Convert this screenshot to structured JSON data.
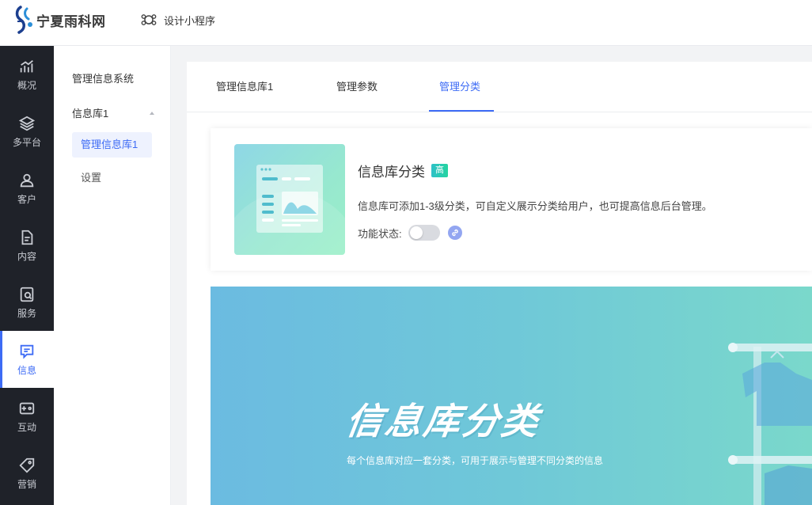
{
  "app": {
    "brand": "宁夏雨科网",
    "design_link": "设计小程序"
  },
  "rail": {
    "items": [
      {
        "label": "概况",
        "icon": "trend-chart-icon"
      },
      {
        "label": "多平台",
        "icon": "layers-icon"
      },
      {
        "label": "客户",
        "icon": "user-icon"
      },
      {
        "label": "内容",
        "icon": "document-icon"
      },
      {
        "label": "服务",
        "icon": "service-icon"
      },
      {
        "label": "信息",
        "icon": "message-icon",
        "active": true
      },
      {
        "label": "互动",
        "icon": "interact-icon"
      },
      {
        "label": "营销",
        "icon": "tag-icon"
      }
    ]
  },
  "subnav": {
    "title": "管理信息系统",
    "group": "信息库1",
    "items": [
      "管理信息库1",
      "设置"
    ]
  },
  "tabs": [
    "管理信息库1",
    "管理参数",
    "管理分类"
  ],
  "active_tab": "管理分类",
  "feature": {
    "title": "信息库分类",
    "badge": "高",
    "description": "信息库可添加1-3级分类，可自定义展示分类给用户，也可提高信息后台管理。",
    "status_label": "功能状态:",
    "enabled": false
  },
  "banner": {
    "title": "信息库分类",
    "subtitle": "每个信息库对应一套分类，可用于展示与管理不同分类的信息"
  },
  "colors": {
    "accent": "#3d6bf5",
    "rail_bg": "#1f2229"
  }
}
